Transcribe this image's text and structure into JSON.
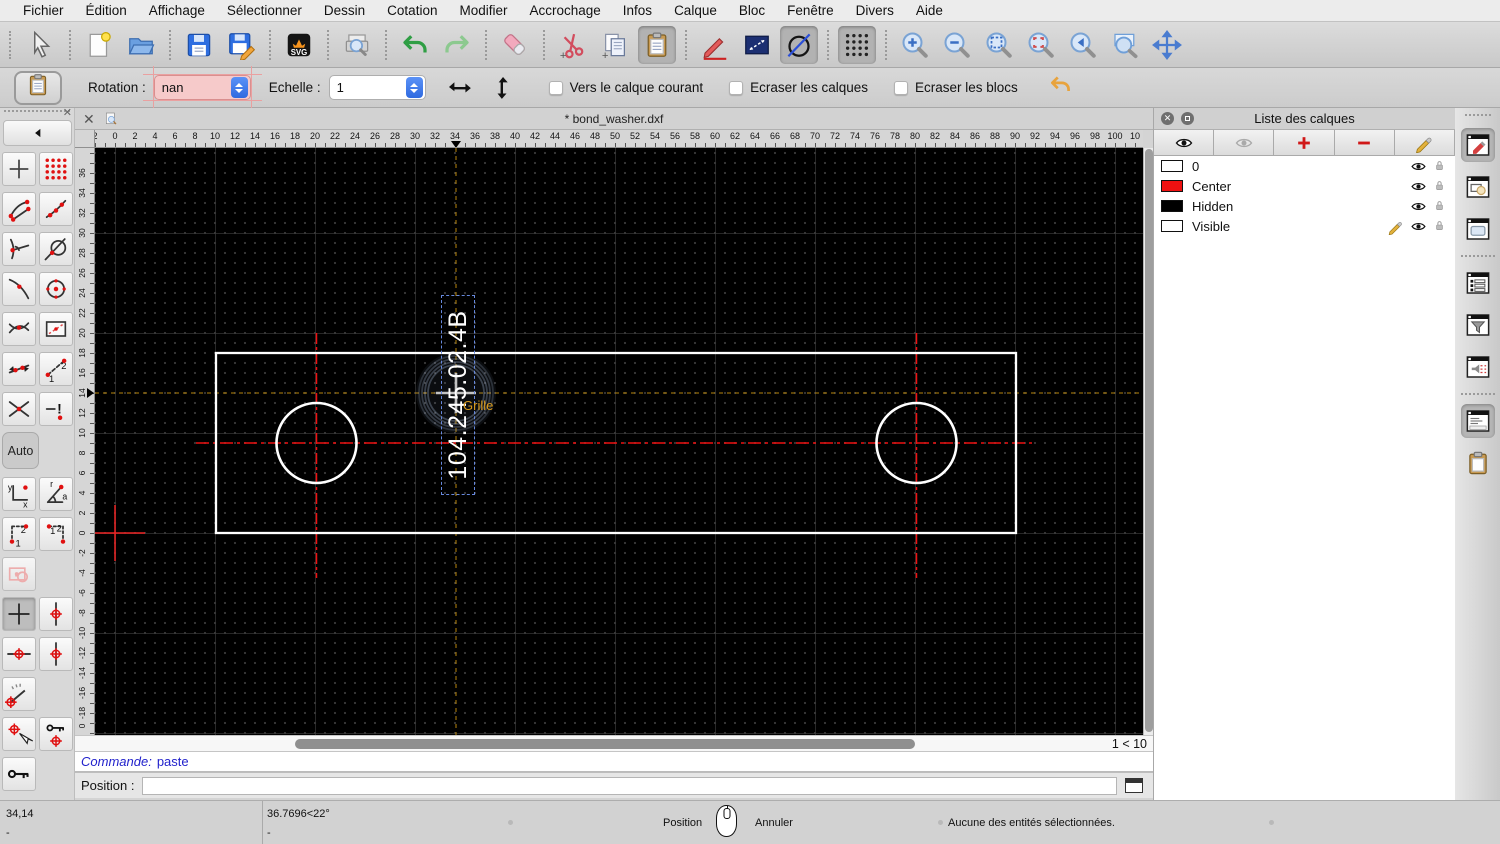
{
  "menu": {
    "items": [
      "Fichier",
      "Édition",
      "Affichage",
      "Sélectionner",
      "Dessin",
      "Cotation",
      "Modifier",
      "Accrochage",
      "Infos",
      "Calque",
      "Bloc",
      "Fenêtre",
      "Divers",
      "Aide"
    ]
  },
  "toolbar": {
    "groups": [
      [
        "select-cursor"
      ],
      [
        "new-file",
        "open-file"
      ],
      [
        "save-file",
        "save-file-as"
      ],
      [
        "export-svg"
      ],
      [
        "print-preview"
      ],
      [
        "undo",
        "redo"
      ],
      [
        "eraser"
      ],
      [
        "cut",
        "copy",
        "paste"
      ],
      [
        "draw-pencil",
        "measure-distance",
        "draw-circle-line"
      ],
      [
        "grid-toggle"
      ],
      [
        "zoom-in",
        "zoom-out",
        "zoom-auto",
        "zoom-redraw",
        "zoom-previous",
        "zoom-window",
        "zoom-pan"
      ]
    ],
    "pressed": [
      "paste",
      "draw-circle-line",
      "grid-toggle"
    ]
  },
  "options_bar": {
    "rotation_label": "Rotation :",
    "rotation_value": "nan",
    "scale_label": "Echelle :",
    "scale_value": "1",
    "checkboxes": [
      "Vers le calque courant",
      "Ecraser les calques",
      "Ecraser les blocs"
    ]
  },
  "tab_bar": {
    "title": "* bond_washer.dxf"
  },
  "snap_palette": {
    "auto_label": "Auto",
    "rows_top": [
      [
        "snap-free",
        "snap-grid"
      ],
      [
        "snap-endpoint",
        "snap-on-entity"
      ],
      [
        "snap-perpendicular",
        "snap-tangent"
      ],
      [
        "snap-middle",
        "snap-center"
      ],
      [
        "snap-intersection",
        "snap-reference-box"
      ],
      [
        "restrict-directions",
        "snap-distance"
      ],
      [
        "cross-intersection",
        "restrict-nothing"
      ]
    ],
    "rows_bottom": [
      [
        "coords-cartesian",
        "coords-polar"
      ],
      [
        "corner-snap-1",
        "corner-snap-2"
      ],
      [
        "selection-preview"
      ],
      [
        "crosshair-plain",
        "crosshair-full"
      ],
      [
        "crosshair-horizontal",
        "crosshair-vertical"
      ],
      [
        "angle-gauge"
      ],
      [
        "move-reference",
        "lock-reference"
      ],
      [
        "key-lock"
      ]
    ],
    "pressed": [
      "crosshair-plain"
    ],
    "disabled": [
      "selection-preview"
    ]
  },
  "rulers": {
    "h_labels": [
      "2",
      "0",
      "2",
      "4",
      "6",
      "8",
      "10",
      "12",
      "14",
      "16",
      "18",
      "20",
      "22",
      "24",
      "26",
      "28",
      "30",
      "32",
      "34",
      "36",
      "38",
      "40",
      "42",
      "44",
      "46",
      "48",
      "50",
      "52",
      "54",
      "56",
      "58",
      "60",
      "62",
      "64",
      "66",
      "68",
      "70",
      "72",
      "74",
      "76",
      "78",
      "80",
      "82",
      "84",
      "86",
      "88",
      "90",
      "92",
      "94",
      "96",
      "98",
      "100",
      "10"
    ],
    "v_labels": [
      "36",
      "34",
      "32",
      "30",
      "28",
      "26",
      "24",
      "22",
      "20",
      "18",
      "16",
      "14",
      "12",
      "10",
      "8",
      "6",
      "4",
      "2",
      "0",
      "-2",
      "-4",
      "-6",
      "-8",
      "-10",
      "-12",
      "-14",
      "-16",
      "-18",
      "0"
    ]
  },
  "canvas": {
    "part_text": "104.245.02.4B",
    "snap_label": "Grille",
    "page_indicator": "1 < 10"
  },
  "command_bar": {
    "prefix": "Commande:",
    "value": "paste"
  },
  "position_bar": {
    "label": "Position :"
  },
  "layers_panel": {
    "title": "Liste des calques",
    "tools": [
      "show-all-layers",
      "hide-all-layers",
      "add-layer",
      "remove-layer",
      "edit-layer"
    ],
    "layers": [
      {
        "name": "0",
        "color": "#ffffff",
        "editable": false
      },
      {
        "name": "Center",
        "color": "#ee1111",
        "editable": false
      },
      {
        "name": "Hidden",
        "color": "#000000",
        "editable": false
      },
      {
        "name": "Visible",
        "color": "#ffffff",
        "editable": true
      }
    ]
  },
  "dock": {
    "buttons": [
      "dock-layers",
      "dock-blocks",
      "dock-library",
      "dock-block-items",
      "dock-filter",
      "dock-hatch",
      "dock-command",
      "dock-clipboard"
    ],
    "selected": [
      "dock-layers",
      "dock-command"
    ]
  },
  "status_bar": {
    "coord": "34,14",
    "coord_alt": "-",
    "polar": "36.7696<22°",
    "polar_alt": "-",
    "mouse_left": "Position",
    "mouse_right": "Annuler",
    "message": "Aucune des entités sélectionnées."
  },
  "colors": {
    "centerline_red": "#ee1111",
    "snap_orange": "#cc8a1a",
    "selection_blue": "#6688dd",
    "entity_white": "#ffffff",
    "error_field_pink": "#f6caca"
  }
}
